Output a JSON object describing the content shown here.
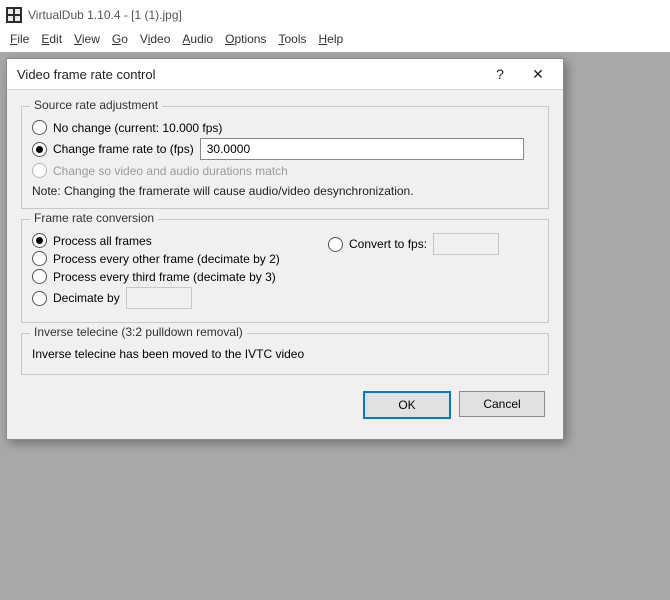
{
  "app": {
    "title": "VirtualDub 1.10.4 - [1 (1).jpg]"
  },
  "menu": {
    "file": "File",
    "edit": "Edit",
    "view": "View",
    "go": "Go",
    "video": "Video",
    "audio": "Audio",
    "options": "Options",
    "tools": "Tools",
    "help": "Help"
  },
  "dialog": {
    "title": "Video frame rate control",
    "help_symbol": "?",
    "close_symbol": "✕",
    "source_group": {
      "legend": "Source rate adjustment",
      "no_change": "No change (current: 10.000 fps)",
      "change_to": "Change frame rate to (fps)",
      "change_value": "30.0000",
      "match_durations": "Change so video and audio durations match",
      "note": "Note: Changing the framerate will cause audio/video desynchronization."
    },
    "conversion_group": {
      "legend": "Frame rate conversion",
      "process_all": "Process all frames",
      "every_other": "Process every other frame (decimate by 2)",
      "every_third": "Process every third frame (decimate by 3)",
      "decimate_by": "Decimate by",
      "decimate_value": "",
      "convert_to_fps": "Convert to fps:",
      "convert_value": ""
    },
    "ivtc_group": {
      "legend": "Inverse telecine (3:2 pulldown removal)",
      "msg": "Inverse telecine has been moved to the IVTC video"
    },
    "buttons": {
      "ok": "OK",
      "cancel": "Cancel"
    }
  }
}
